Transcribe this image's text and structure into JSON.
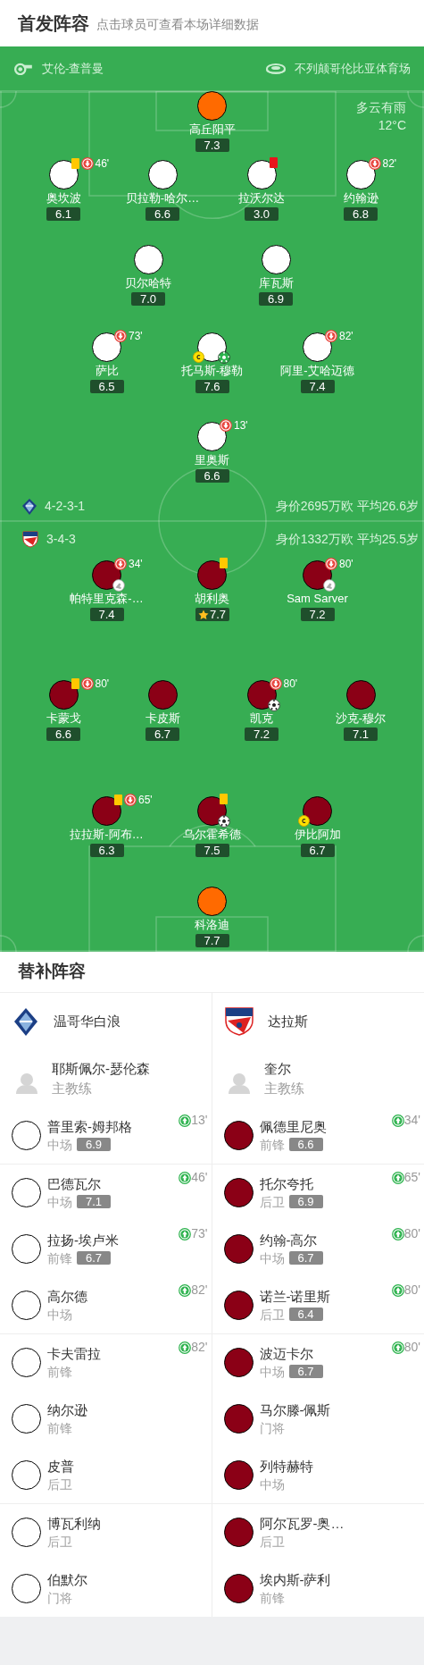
{
  "header": {
    "title": "首发阵容",
    "subtitle": "点击球员可查看本场详细数据"
  },
  "match_info": {
    "referee": "艾伦-查普曼",
    "stadium": "不列颠哥伦比亚体育场",
    "weather": "多云有雨",
    "temperature": "12°C"
  },
  "lineups": [
    {
      "color": "#ffffff",
      "formation": "4-2-3-1",
      "value_info": "身价2695万欧 平均26.6岁",
      "lines": [
        {
          "players": [
            {
              "name": "高丘阳平",
              "rating": "7.3",
              "kind": "goalkeeper",
              "color": "#ff6a00"
            }
          ]
        },
        {
          "players": [
            {
              "name": "奥坎波",
              "rating": "6.1",
              "kind": "outfield",
              "marks": [
                {
                  "kind": "yellow_card"
                },
                {
                  "kind": "sub_off",
                  "minute": "46'"
                }
              ]
            },
            {
              "name": "贝拉勒-哈尔…",
              "rating": "6.6",
              "kind": "outfield"
            },
            {
              "name": "拉沃尔达",
              "rating": "3.0",
              "kind": "outfield",
              "marks": [
                {
                  "kind": "red_card"
                }
              ]
            },
            {
              "name": "约翰逊",
              "rating": "6.8",
              "kind": "outfield",
              "marks": [
                {
                  "kind": "sub_off",
                  "minute": "82'"
                }
              ]
            }
          ]
        },
        {
          "players": [
            {
              "name": "贝尔哈特",
              "rating": "7.0",
              "kind": "outfield"
            },
            {
              "name": "库瓦斯",
              "rating": "6.9",
              "kind": "outfield"
            }
          ]
        },
        {
          "players": [
            {
              "name": "萨比",
              "rating": "6.5",
              "kind": "outfield",
              "marks": [
                {
                  "kind": "sub_off",
                  "minute": "73'"
                }
              ]
            },
            {
              "name": "托马斯-穆勒",
              "rating": "7.6",
              "kind": "outfield",
              "marks": [
                {
                  "kind": "captain"
                },
                {
                  "kind": "green_ball"
                }
              ]
            },
            {
              "name": "阿里-艾哈迈德",
              "rating": "7.4",
              "kind": "outfield",
              "marks": [
                {
                  "kind": "sub_off",
                  "minute": "82'"
                }
              ]
            }
          ]
        },
        {
          "players": [
            {
              "name": "里奥斯",
              "rating": "6.6",
              "kind": "outfield",
              "marks": [
                {
                  "kind": "sub_off",
                  "minute": "13'"
                }
              ]
            }
          ]
        }
      ]
    },
    {
      "color": "#8b0016",
      "formation": "3-4-3",
      "value_info": "身价1332万欧 平均25.5岁",
      "lines": [
        {
          "players": [
            {
              "name": "帕特里克森-…",
              "rating": "7.4",
              "kind": "outfield",
              "marks": [
                {
                  "kind": "sub_off",
                  "minute": "34'"
                },
                {
                  "kind": "assist"
                }
              ]
            },
            {
              "name": "胡利奥",
              "rating": "7.7",
              "kind": "outfield",
              "marks": [
                {
                  "kind": "yellow_card"
                },
                {
                  "kind": "star"
                }
              ]
            },
            {
              "name": "Sam Sarver",
              "rating": "7.2",
              "kind": "outfield",
              "marks": [
                {
                  "kind": "sub_off",
                  "minute": "80'"
                },
                {
                  "kind": "assist"
                }
              ]
            }
          ]
        },
        {
          "players": [
            {
              "name": "卡蒙戈",
              "rating": "6.6",
              "kind": "outfield",
              "marks": [
                {
                  "kind": "yellow_card"
                },
                {
                  "kind": "sub_off",
                  "minute": "80'"
                }
              ]
            },
            {
              "name": "卡皮斯",
              "rating": "6.7",
              "kind": "outfield"
            },
            {
              "name": "凯克",
              "rating": "7.2",
              "kind": "outfield",
              "marks": [
                {
                  "kind": "sub_off",
                  "minute": "80'"
                },
                {
                  "kind": "goal"
                }
              ]
            },
            {
              "name": "沙克-穆尔",
              "rating": "7.1",
              "kind": "outfield"
            }
          ]
        },
        {
          "players": [
            {
              "name": "拉拉斯-阿布…",
              "rating": "6.3",
              "kind": "outfield",
              "marks": [
                {
                  "kind": "yellow_card"
                },
                {
                  "kind": "sub_off",
                  "minute": "65'"
                }
              ]
            },
            {
              "name": "乌尔霍希德",
              "rating": "7.5",
              "kind": "outfield",
              "marks": [
                {
                  "kind": "yellow_card"
                },
                {
                  "kind": "goal"
                }
              ]
            },
            {
              "name": "伊比阿加",
              "rating": "6.7",
              "kind": "outfield",
              "marks": [
                {
                  "kind": "captain"
                }
              ]
            }
          ]
        },
        {
          "players": [
            {
              "name": "科洛迪",
              "rating": "7.7",
              "kind": "goalkeeper",
              "color": "#ff6a00"
            }
          ]
        }
      ]
    }
  ],
  "substitutes": {
    "title": "替补阵容",
    "teams": [
      {
        "name": "温哥华白浪",
        "coach": "耶斯佩尔-瑟伦森",
        "coach_role": "主教练"
      },
      {
        "name": "达拉斯",
        "coach": "奎尔",
        "coach_role": "主教练"
      }
    ],
    "groups": [
      [
        {
          "left": {
            "name": "普里索-姆邦格",
            "position": "中场",
            "rating": "6.9",
            "sub_in": "13'"
          },
          "right": {
            "name": "佩德里尼奥",
            "position": "前锋",
            "rating": "6.6",
            "sub_in": "34'"
          }
        }
      ],
      [
        {
          "left": {
            "name": "巴德瓦尔",
            "position": "中场",
            "rating": "7.1",
            "sub_in": "46'"
          },
          "right": {
            "name": "托尔夸托",
            "position": "后卫",
            "rating": "6.9",
            "sub_in": "65'"
          }
        },
        {
          "left": {
            "name": "拉扬-埃卢米",
            "position": "前锋",
            "rating": "6.7",
            "sub_in": "73'"
          },
          "right": {
            "name": "约翰-高尔",
            "position": "中场",
            "rating": "6.7",
            "sub_in": "80'"
          }
        },
        {
          "left": {
            "name": "高尔德",
            "position": "中场",
            "sub_in": "82'"
          },
          "right": {
            "name": "诺兰-诺里斯",
            "position": "后卫",
            "rating": "6.4",
            "sub_in": "80'"
          }
        }
      ],
      [
        {
          "left": {
            "name": "卡夫雷拉",
            "position": "前锋",
            "sub_in": "82'"
          },
          "right": {
            "name": "波迈卡尔",
            "position": "中场",
            "rating": "6.7",
            "sub_in": "80'"
          }
        },
        {
          "left": {
            "name": "纳尔逊",
            "position": "前锋"
          },
          "right": {
            "name": "马尔滕-佩斯",
            "position": "门将"
          }
        },
        {
          "left": {
            "name": "皮普",
            "position": "后卫"
          },
          "right": {
            "name": "列特赫特",
            "position": "中场"
          }
        }
      ],
      [
        {
          "left": {
            "name": "博瓦利纳",
            "position": "后卫"
          },
          "right": {
            "name": "阿尔瓦罗-奥…",
            "position": "后卫"
          }
        },
        {
          "left": {
            "name": "伯默尔",
            "position": "门将"
          },
          "right": {
            "name": "埃内斯-萨利",
            "position": "前锋"
          }
        }
      ]
    ]
  }
}
